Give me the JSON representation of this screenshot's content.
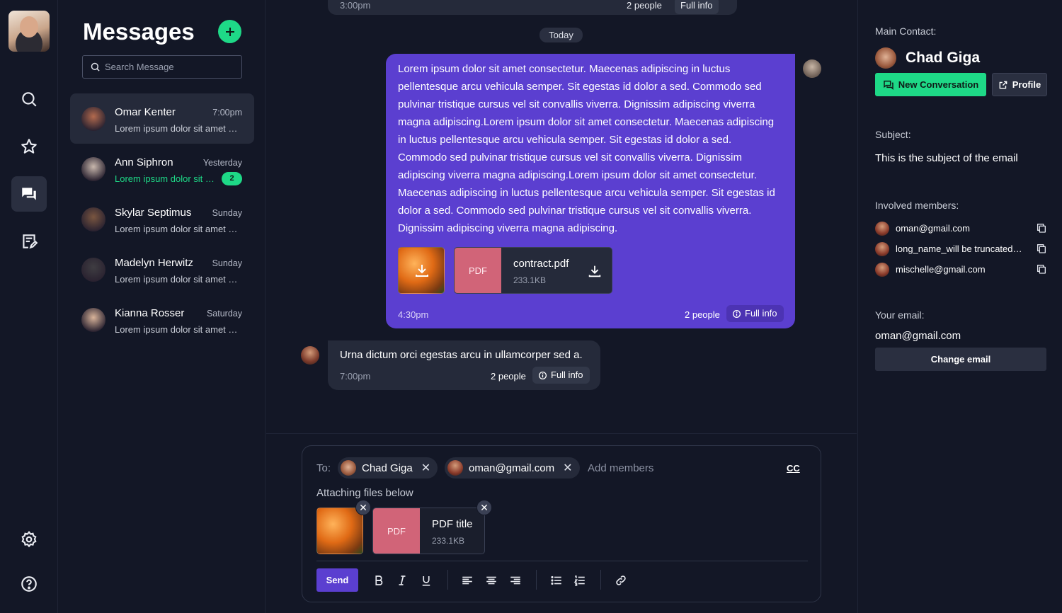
{
  "rail": {
    "items": [
      "search-icon",
      "star-icon",
      "chat-icon",
      "notes-icon",
      "gear-icon",
      "help-icon"
    ],
    "active": "chat-icon"
  },
  "messages": {
    "title": "Messages",
    "search_placeholder": "Search Message",
    "conversations": [
      {
        "name": "Omar Kenter",
        "time": "7:00pm",
        "preview": "Lorem ipsum dolor sit amet consectetur adipiscing",
        "active": true,
        "unread": 0,
        "avatar_color": "#b36a4e"
      },
      {
        "name": "Ann Siphron",
        "time": "Yesterday",
        "preview": "Lorem ipsum dolor sit amet consectetur",
        "active": false,
        "unread": "2",
        "avatar_color": "#c9b8ad"
      },
      {
        "name": "Skylar Septimus",
        "time": "Sunday",
        "preview": "Lorem ipsum dolor sit amet consectetur adipiscing",
        "active": false,
        "unread": 0,
        "avatar_color": "#7a5640"
      },
      {
        "name": "Madelyn Herwitz",
        "time": "Sunday",
        "preview": "Lorem ipsum dolor sit amet consectetur adipiscing",
        "active": false,
        "unread": 0,
        "avatar_color": "#3f3d42"
      },
      {
        "name": "Kianna Rosser",
        "time": "Saturday",
        "preview": "Lorem ipsum dolor sit amet consectetur adipiscing",
        "active": false,
        "unread": 0,
        "avatar_color": "#d9b49a"
      }
    ]
  },
  "chat": {
    "previous": {
      "time": "3:00pm",
      "people": "2 people",
      "info": "Full info"
    },
    "day_divider": "Today",
    "outgoing": {
      "text": "Lorem ipsum dolor sit amet consectetur. Maecenas adipiscing in luctus pellentesque arcu vehicula semper. Sit egestas id dolor a sed. Commodo sed pulvinar tristique cursus vel sit convallis viverra. Dignissim adipiscing viverra magna adipiscing.Lorem ipsum dolor sit amet consectetur. Maecenas adipiscing in luctus pellentesque arcu vehicula semper. Sit egestas id dolor a sed. Commodo sed pulvinar tristique cursus vel sit convallis viverra. Dignissim adipiscing viverra magna adipiscing.Lorem ipsum dolor sit amet consectetur. Maecenas adipiscing in luctus pellentesque arcu vehicula semper. Sit egestas id dolor a sed. Commodo sed pulvinar tristique cursus vel sit convallis viverra. Dignissim adipiscing viverra magna adipiscing.",
      "file_tag": "PDF",
      "file_name": "contract.pdf",
      "file_size": "233.1KB",
      "time": "4:30pm",
      "people": "2 people",
      "info": "Full info"
    },
    "incoming": {
      "text": "Urna dictum orci egestas arcu in ullamcorper sed a.",
      "time": "7:00pm",
      "people": "2 people",
      "info": "Full info"
    }
  },
  "composer": {
    "to_label": "To:",
    "recipients": [
      "Chad Giga",
      "oman@gmail.com"
    ],
    "add_placeholder": "Add members",
    "cc": "CC",
    "attach_label": "Attaching files below",
    "file_tag": "PDF",
    "file_title": "PDF title",
    "file_size": "233.1KB",
    "send": "Send"
  },
  "details": {
    "main_contact_label": "Main Contact:",
    "main_contact_name": "Chad Giga",
    "new_conversation": "New Conversation",
    "profile": "Profile",
    "subject_label": "Subject:",
    "subject": "This is the subject of the email",
    "members_label": "Involved members:",
    "members": [
      "oman@gmail.com",
      "long_name_will be truncated_here@gmail.com",
      "mischelle@gmail.com"
    ],
    "your_email_label": "Your email:",
    "your_email": "oman@gmail.com",
    "change_email": "Change email"
  },
  "colors": {
    "background": "#131726",
    "accent": "#5b3fd0",
    "success": "#1ed987",
    "pdf": "#d16478"
  }
}
